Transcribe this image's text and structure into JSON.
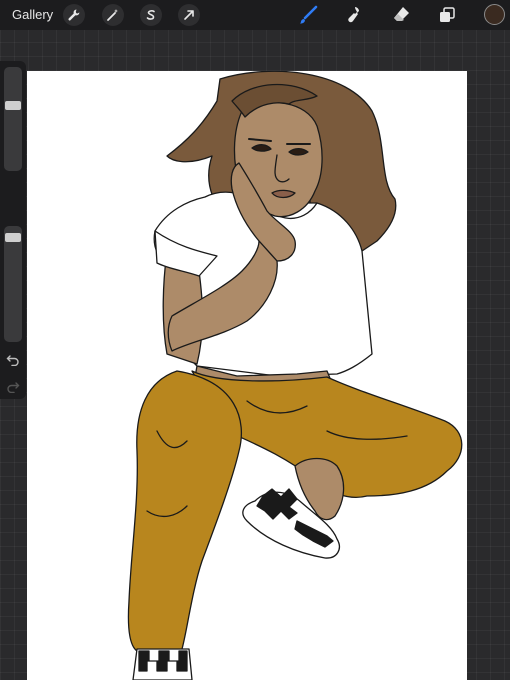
{
  "app": {
    "gallery_label": "Gallery"
  },
  "toolbar": {
    "left_tools": [
      "wrench-icon",
      "magic-wand-icon",
      "selection-icon",
      "transform-arrow-icon"
    ],
    "right_tools": [
      "brush-icon",
      "smudge-icon",
      "eraser-icon",
      "layers-icon"
    ],
    "active_tool": "brush-icon",
    "active_color": "#3a2a20",
    "accent_color": "#2f7cf6"
  },
  "sidebar": {
    "brush_size_level": 0.65,
    "opacity_level": 0.95,
    "icons": [
      "modify-button",
      "undo-icon",
      "redo-icon"
    ]
  },
  "artwork": {
    "colors": {
      "skin": "#ad8b69",
      "hair": "#7a5a3c",
      "shirt": "#ffffff",
      "pants": "#b8861e",
      "outline": "#1a1a1a"
    }
  }
}
